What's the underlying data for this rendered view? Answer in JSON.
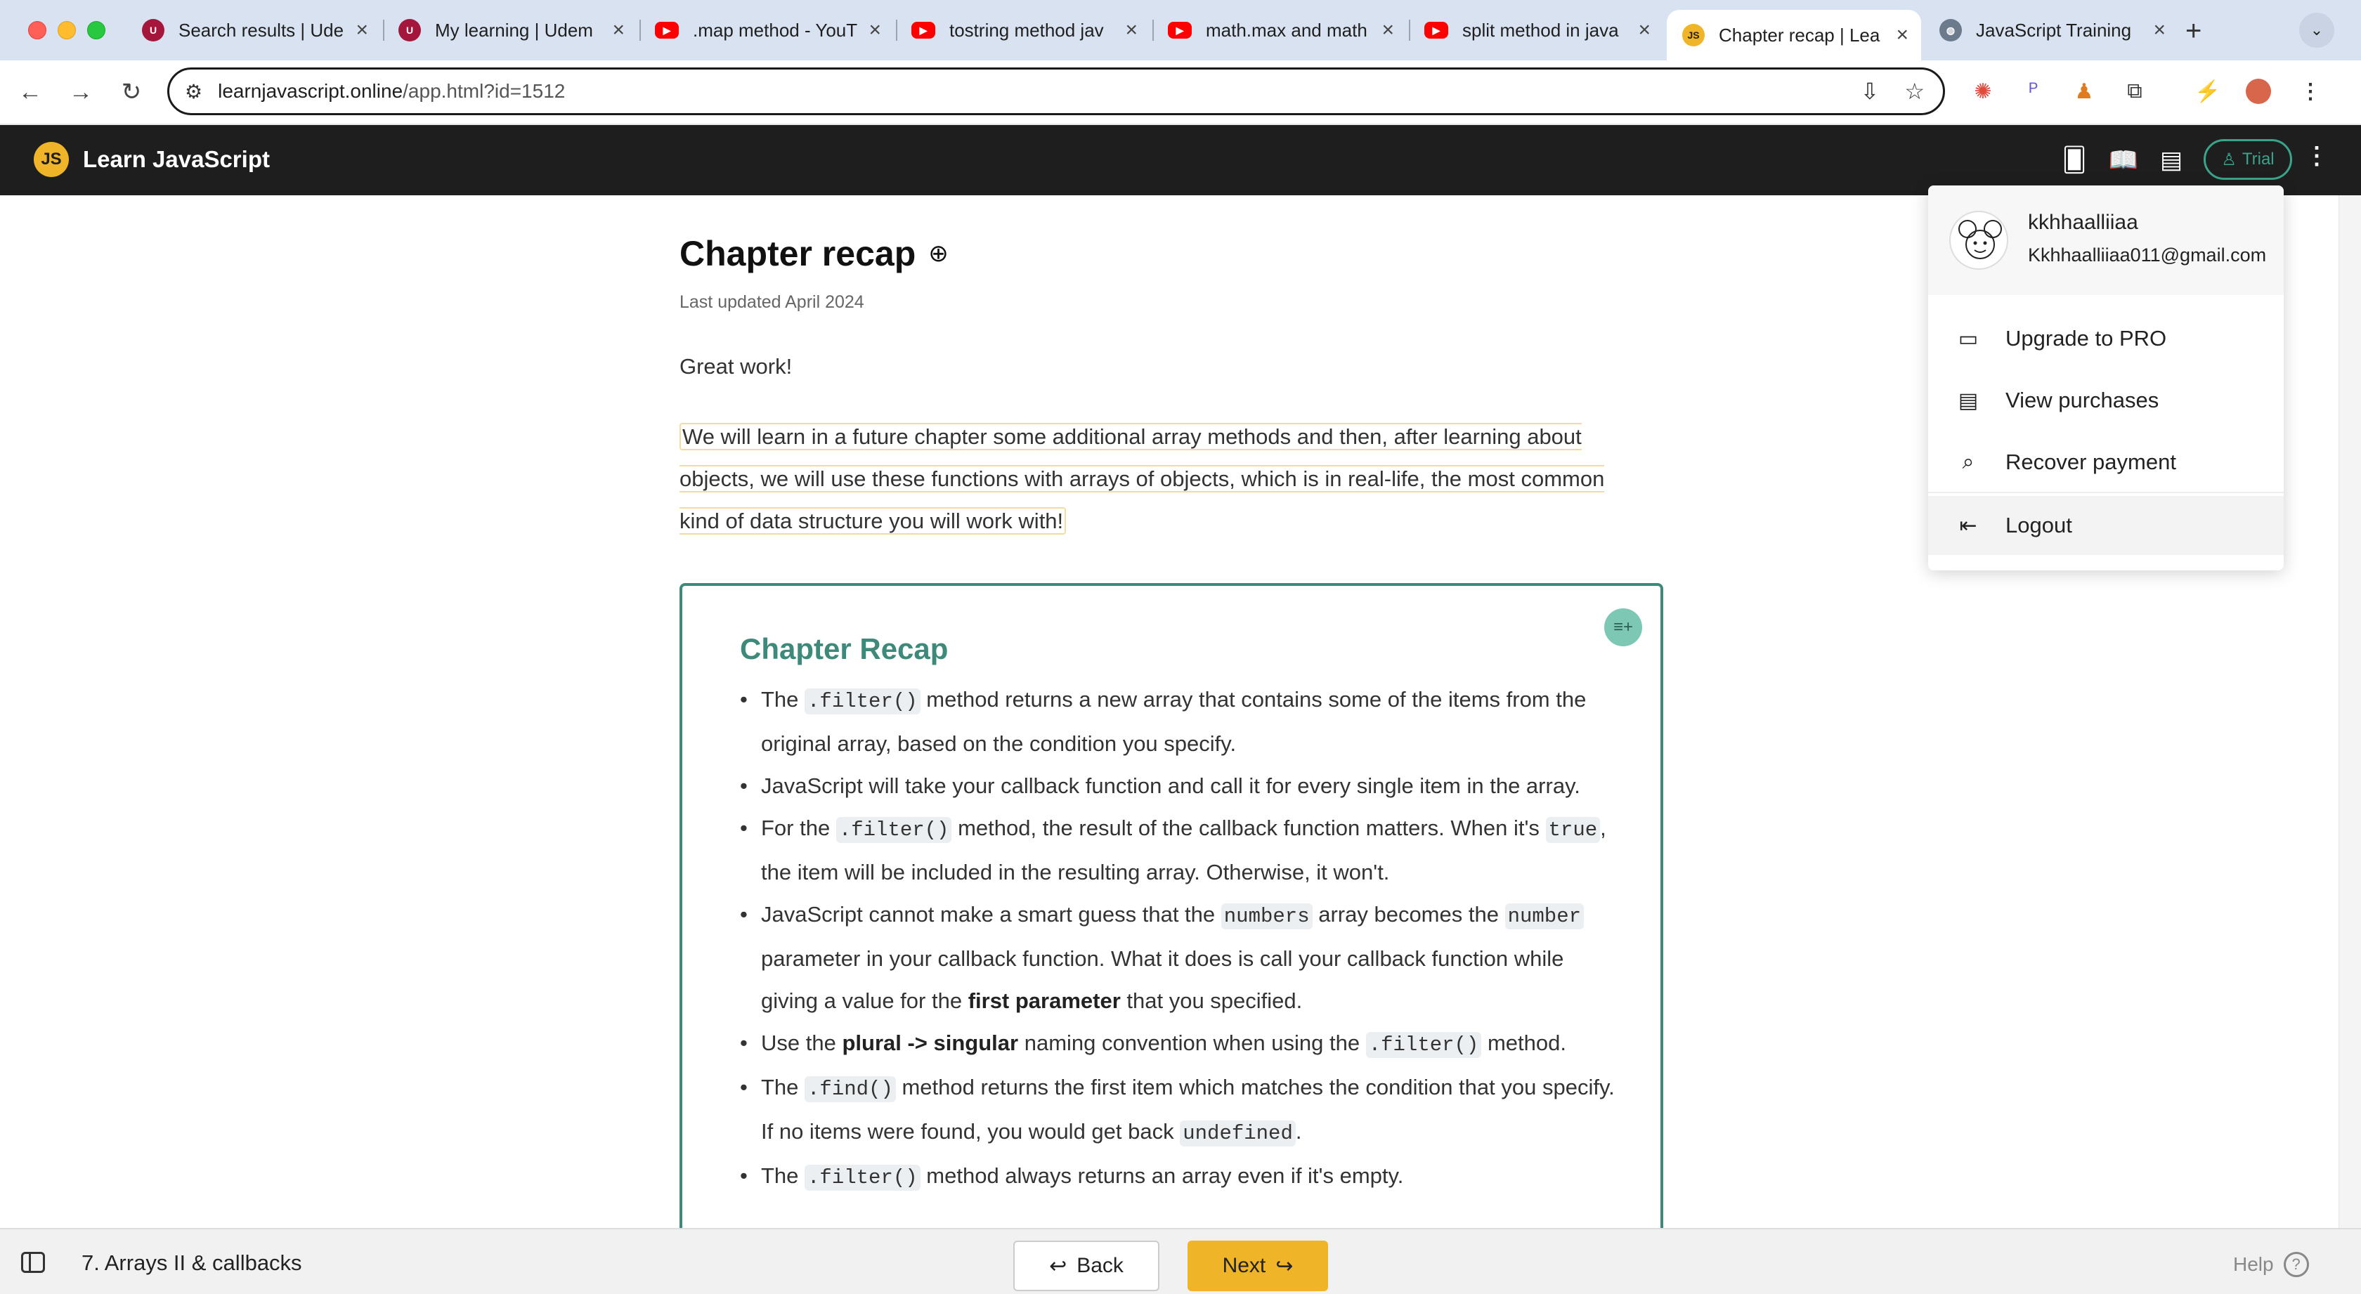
{
  "browser": {
    "tabs": [
      {
        "title": "Search results | Ude",
        "favicon": "udemy-icon"
      },
      {
        "title": "My learning | Udem",
        "favicon": "udemy-icon"
      },
      {
        "title": ".map method - YouT",
        "favicon": "youtube-icon"
      },
      {
        "title": "tostring method jav",
        "favicon": "youtube-icon"
      },
      {
        "title": "math.max and math",
        "favicon": "youtube-icon"
      },
      {
        "title": "split method in java",
        "favicon": "youtube-icon"
      },
      {
        "title": "Chapter recap | Lea",
        "favicon": "js-icon",
        "active": true
      },
      {
        "title": "JavaScript Training",
        "favicon": "globe-icon"
      }
    ],
    "url_host": "learnjavascript.online",
    "url_path": "/app.html?id=1512"
  },
  "app": {
    "logo_text": "JS",
    "brand": "Learn JavaScript",
    "trial_label": "Trial"
  },
  "lesson": {
    "title": "Chapter recap",
    "updated": "Last updated April 2024",
    "intro": "Great work!",
    "paragraph": "We will learn in a future chapter some additional array methods and then, after learning about objects, we will use these functions with arrays of objects, which is in real-life, the most common kind of data structure you will work with!",
    "recap_title": "Chapter Recap",
    "recap_items": [
      [
        {
          "t": "The "
        },
        {
          "c": ".filter()"
        },
        {
          "t": " method returns a new array that contains some of the items from the original array, based on the condition you specify."
        }
      ],
      [
        {
          "t": "JavaScript will take your callback function and call it for every single item in the array."
        }
      ],
      [
        {
          "t": "For the "
        },
        {
          "c": ".filter()"
        },
        {
          "t": " method, the result of the callback function matters. When it's "
        },
        {
          "c": "true"
        },
        {
          "t": ", the item will be included in the resulting array. Otherwise, it won't."
        }
      ],
      [
        {
          "t": "JavaScript cannot make a smart guess that the "
        },
        {
          "c": "numbers"
        },
        {
          "t": " array becomes the "
        },
        {
          "c": "number"
        },
        {
          "t": " parameter in your callback function. What it does is call your callback function while giving a value for the "
        },
        {
          "b": "first parameter"
        },
        {
          "t": " that you specified."
        }
      ],
      [
        {
          "t": "Use the "
        },
        {
          "b": "plural -> singular"
        },
        {
          "t": " naming convention when using the "
        },
        {
          "c": ".filter()"
        },
        {
          "t": " method."
        }
      ],
      [
        {
          "t": "The "
        },
        {
          "c": ".find()"
        },
        {
          "t": " method returns the first item which matches the condition that you specify. If no items were found, you would get back "
        },
        {
          "c": "undefined"
        },
        {
          "t": "."
        }
      ],
      [
        {
          "t": "The "
        },
        {
          "c": ".filter()"
        },
        {
          "t": " method always returns an array even if it's empty."
        }
      ]
    ]
  },
  "footer": {
    "chapter": "7. Arrays II & callbacks",
    "back": "Back",
    "next": "Next",
    "help": "Help"
  },
  "menu": {
    "username": "kkhhaalliiaa",
    "email": "Kkhhaalliiaa011@gmail.com",
    "items": [
      {
        "label": "Upgrade to PRO",
        "icon": "credit-card-icon"
      },
      {
        "label": "View purchases",
        "icon": "receipt-icon"
      },
      {
        "label": "Recover payment",
        "icon": "receipt-search-icon"
      },
      {
        "label": "Logout",
        "icon": "logout-icon"
      }
    ]
  },
  "colors": {
    "accent": "#3d8a7a",
    "brand_yellow": "#f0b429",
    "header_bg": "#1e1e1e"
  }
}
